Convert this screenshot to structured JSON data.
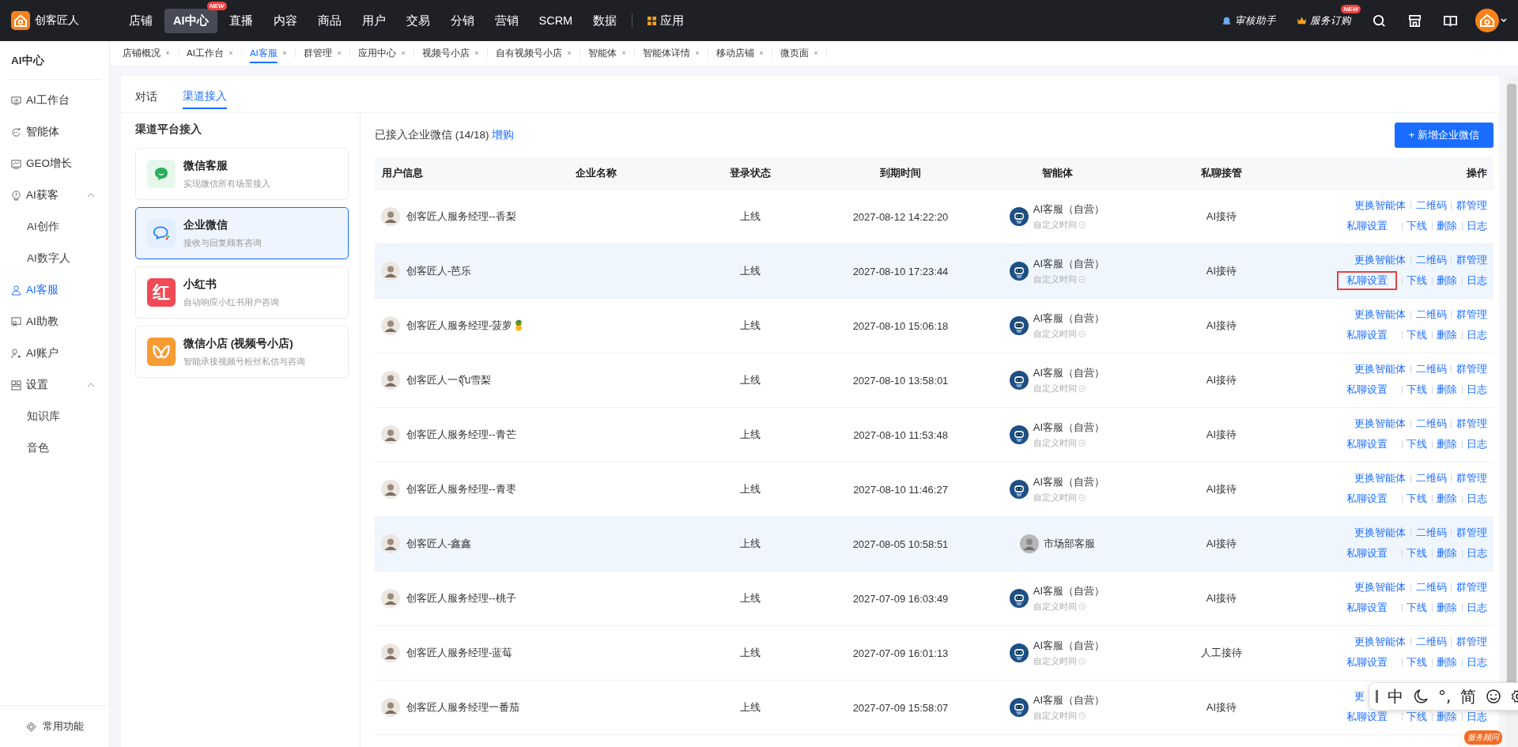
{
  "brand": {
    "name": "创客匠人"
  },
  "top_nav": [
    {
      "label": "店铺",
      "selected": false
    },
    {
      "label": "AI中心",
      "selected": true,
      "badge": "NEW"
    },
    {
      "label": "直播",
      "selected": false
    },
    {
      "label": "内容",
      "selected": false
    },
    {
      "label": "商品",
      "selected": false
    },
    {
      "label": "用户",
      "selected": false
    },
    {
      "label": "交易",
      "selected": false
    },
    {
      "label": "分销",
      "selected": false
    },
    {
      "label": "营销",
      "selected": false
    },
    {
      "label": "SCRM",
      "selected": false
    },
    {
      "label": "数据",
      "selected": false
    }
  ],
  "apps_label": "应用",
  "top_right": [
    {
      "kind": "bell",
      "label": "审核助手"
    },
    {
      "kind": "crown",
      "label": "服务订购",
      "badge": "NEW"
    }
  ],
  "sidebar": {
    "title": "AI中心",
    "items": [
      {
        "label": "AI工作台",
        "selected": false
      },
      {
        "label": "智能体",
        "selected": false
      },
      {
        "label": "GEO增长",
        "selected": false
      },
      {
        "label": "AI获客",
        "selected": false,
        "expanded": true,
        "children": [
          {
            "label": "AI创作",
            "selected": false
          },
          {
            "label": "AI数字人",
            "selected": false
          }
        ]
      },
      {
        "label": "AI客服",
        "selected": true
      },
      {
        "label": "AI助教",
        "selected": false
      },
      {
        "label": "AI账户",
        "selected": false
      },
      {
        "label": "设置",
        "selected": false,
        "expanded": true,
        "children": [
          {
            "label": "知识库",
            "selected": false
          },
          {
            "label": "音色",
            "selected": false
          }
        ]
      }
    ],
    "footer": "常用功能"
  },
  "page_tabs": [
    {
      "label": "店铺概况",
      "selected": false
    },
    {
      "label": "AI工作台",
      "selected": false
    },
    {
      "label": "AI客服",
      "selected": true
    },
    {
      "label": "群管理",
      "selected": false
    },
    {
      "label": "应用中心",
      "selected": false
    },
    {
      "label": "视频号小店",
      "selected": false
    },
    {
      "label": "自有视频号小店",
      "selected": false
    },
    {
      "label": "智能体",
      "selected": false
    },
    {
      "label": "智能体详情",
      "selected": false
    },
    {
      "label": "移动店铺",
      "selected": false
    },
    {
      "label": "微页面",
      "selected": false
    }
  ],
  "sub_tabs": [
    {
      "label": "对话",
      "selected": false
    },
    {
      "label": "渠道接入",
      "selected": true
    }
  ],
  "channels": {
    "title": "渠道平台接入",
    "items": [
      {
        "kind": "wechat",
        "name": "微信客服",
        "desc": "实现微信所有场景接入",
        "selected": false
      },
      {
        "kind": "wecom",
        "name": "企业微信",
        "desc": "接收与回复顾客咨询",
        "selected": true
      },
      {
        "kind": "xhs",
        "icon_text": "红",
        "name": "小红书",
        "desc": "自动响应小红书用户咨询",
        "selected": false
      },
      {
        "kind": "shop",
        "name": "微信小店 (视频号小店)",
        "desc": "智能承接视频号粉丝私信与咨询",
        "selected": false
      }
    ]
  },
  "summary": {
    "text": "已接入企业微信 (14/18)",
    "link": "增购"
  },
  "add_button": "+ 新增企业微信",
  "table": {
    "columns": [
      "用户信息",
      "企业名称",
      "登录状态",
      "到期时间",
      "智能体",
      "私聊接管",
      "操作"
    ],
    "rows": [
      {
        "name": "创客匠人服务经理--香梨",
        "status": "上线",
        "expires": "2027-08-12 14:22:20",
        "agent": {
          "kind": "robot",
          "name": "AI客服（自营）",
          "sub": "自定义时间"
        },
        "takeover": "AI接待",
        "ops_top": [
          "更换智能体",
          "二维码",
          "群管理"
        ],
        "ops_bottom": [
          "私聊设置",
          "下线",
          "删除",
          "日志"
        ],
        "highlighted": false,
        "marked": false
      },
      {
        "name": "创客匠人-芭乐",
        "status": "上线",
        "expires": "2027-08-10 17:23:44",
        "agent": {
          "kind": "robot",
          "name": "AI客服（自营）",
          "sub": "自定义时间"
        },
        "takeover": "AI接待",
        "ops_top": [
          "更换智能体",
          "二维码",
          "群管理"
        ],
        "ops_bottom": [
          "私聊设置",
          "下线",
          "删除",
          "日志"
        ],
        "highlighted": true,
        "marked": true
      },
      {
        "name": "创客匠人服务经理-菠萝🍍",
        "status": "上线",
        "expires": "2027-08-10 15:06:18",
        "agent": {
          "kind": "robot",
          "name": "AI客服（自营）",
          "sub": "自定义时间"
        },
        "takeover": "AI接待",
        "ops_top": [
          "更换智能体",
          "二维码",
          "群管理"
        ],
        "ops_bottom": [
          "私聊设置",
          "下线",
          "删除",
          "日志"
        ],
        "highlighted": false,
        "marked": false
      },
      {
        "name": "创客匠人一จุ๊บ雪梨",
        "status": "上线",
        "expires": "2027-08-10 13:58:01",
        "agent": {
          "kind": "robot",
          "name": "AI客服（自营）",
          "sub": "自定义时间"
        },
        "takeover": "AI接待",
        "ops_top": [
          "更换智能体",
          "二维码",
          "群管理"
        ],
        "ops_bottom": [
          "私聊设置",
          "下线",
          "删除",
          "日志"
        ],
        "highlighted": false,
        "marked": false
      },
      {
        "name": "创客匠人服务经理--青芒",
        "status": "上线",
        "expires": "2027-08-10 11:53:48",
        "agent": {
          "kind": "robot",
          "name": "AI客服（自营）",
          "sub": "自定义时间"
        },
        "takeover": "AI接待",
        "ops_top": [
          "更换智能体",
          "二维码",
          "群管理"
        ],
        "ops_bottom": [
          "私聊设置",
          "下线",
          "删除",
          "日志"
        ],
        "highlighted": false,
        "marked": false
      },
      {
        "name": "创客匠人服务经理--青枣",
        "status": "上线",
        "expires": "2027-08-10 11:46:27",
        "agent": {
          "kind": "robot",
          "name": "AI客服（自营）",
          "sub": "自定义时间"
        },
        "takeover": "AI接待",
        "ops_top": [
          "更换智能体",
          "二维码",
          "群管理"
        ],
        "ops_bottom": [
          "私聊设置",
          "下线",
          "删除",
          "日志"
        ],
        "highlighted": false,
        "marked": false
      },
      {
        "name": "创客匠人-鑫鑫",
        "status": "上线",
        "expires": "2027-08-05 10:58:51",
        "agent": {
          "kind": "photo",
          "name": "市场部客服"
        },
        "takeover": "AI接待",
        "ops_top": [
          "更换智能体",
          "二维码",
          "群管理"
        ],
        "ops_bottom": [
          "私聊设置",
          "下线",
          "删除",
          "日志"
        ],
        "highlighted": true,
        "marked": false
      },
      {
        "name": "创客匠人服务经理--桃子",
        "status": "上线",
        "expires": "2027-07-09 16:03:49",
        "agent": {
          "kind": "robot",
          "name": "AI客服（自营）",
          "sub": "自定义时间"
        },
        "takeover": "AI接待",
        "ops_top": [
          "更换智能体",
          "二维码",
          "群管理"
        ],
        "ops_bottom": [
          "私聊设置",
          "下线",
          "删除",
          "日志"
        ],
        "highlighted": false,
        "marked": false
      },
      {
        "name": "创客匠人服务经理-蓝莓",
        "status": "上线",
        "expires": "2027-07-09 16:01:13",
        "agent": {
          "kind": "robot",
          "name": "AI客服（自营）",
          "sub": "自定义时间"
        },
        "takeover": "人工接待",
        "ops_top": [
          "更换智能体",
          "二维码",
          "群管理"
        ],
        "ops_bottom": [
          "私聊设置",
          "下线",
          "删除",
          "日志"
        ],
        "highlighted": false,
        "marked": false
      },
      {
        "name": "创客匠人服务经理一番茄",
        "status": "上线",
        "expires": "2027-07-09 15:58:07",
        "agent": {
          "kind": "robot",
          "name": "AI客服（自营）",
          "sub": "自定义时间"
        },
        "takeover": "AI接待",
        "ops_top": [
          "更"
        ],
        "ops_bottom": [
          "私聊设置",
          "下线",
          "删除",
          "日志"
        ],
        "highlighted": false,
        "marked": false
      }
    ]
  },
  "ime_toolbar": {
    "items": [
      {
        "kind": "text",
        "text": "中"
      },
      {
        "kind": "moon"
      },
      {
        "kind": "text",
        "text": "°,"
      },
      {
        "kind": "text",
        "text": "简"
      },
      {
        "kind": "smile"
      },
      {
        "kind": "gear"
      }
    ]
  },
  "float_badge": "服务顾问"
}
